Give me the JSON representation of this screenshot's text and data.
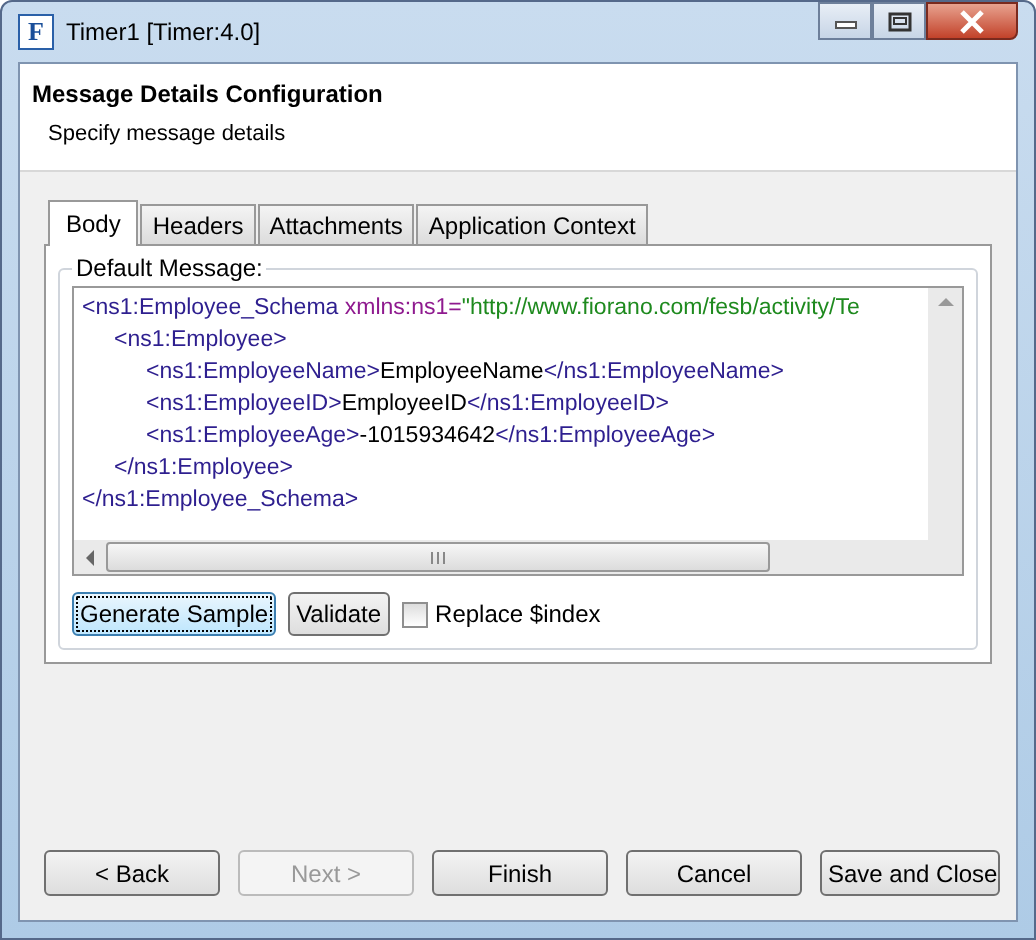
{
  "window": {
    "title": "Timer1 [Timer:4.0]",
    "app_icon": "F"
  },
  "header": {
    "title": "Message Details Configuration",
    "subtitle": "Specify message details"
  },
  "tabs": [
    {
      "label": "Body",
      "selected": true
    },
    {
      "label": "Headers",
      "selected": false
    },
    {
      "label": "Attachments",
      "selected": false
    },
    {
      "label": "Application Context",
      "selected": false
    }
  ],
  "group": {
    "label": "Default Message:"
  },
  "xml": [
    {
      "segments": [
        {
          "kind": "tag",
          "text": "<ns1:Employee_Schema "
        },
        {
          "kind": "attr",
          "text": "xmlns:ns1="
        },
        {
          "kind": "value",
          "text": "\"http://www.fiorano.com/fesb/activity/Te"
        }
      ],
      "children": [
        {
          "segments": [
            {
              "kind": "tag",
              "text": "<ns1:Employee>"
            }
          ],
          "children": [
            {
              "segments": [
                {
                  "kind": "tag",
                  "text": "<ns1:EmployeeName>"
                },
                {
                  "kind": "text",
                  "text": "EmployeeName"
                },
                {
                  "kind": "tag",
                  "text": "</ns1:EmployeeName>"
                }
              ]
            },
            {
              "segments": [
                {
                  "kind": "tag",
                  "text": "<ns1:EmployeeID>"
                },
                {
                  "kind": "text",
                  "text": "EmployeeID"
                },
                {
                  "kind": "tag",
                  "text": "</ns1:EmployeeID>"
                }
              ]
            },
            {
              "segments": [
                {
                  "kind": "tag",
                  "text": "<ns1:EmployeeAge>"
                },
                {
                  "kind": "text",
                  "text": "-1015934642"
                },
                {
                  "kind": "tag",
                  "text": "</ns1:EmployeeAge>"
                }
              ]
            }
          ]
        },
        {
          "segments": [
            {
              "kind": "tag",
              "text": "</ns1:Employee>"
            }
          ]
        }
      ]
    },
    {
      "segments": [
        {
          "kind": "tag",
          "text": "</ns1:Employee_Schema>"
        }
      ]
    }
  ],
  "actions": [
    {
      "label": "Generate Sample",
      "focused": true
    },
    {
      "label": "Validate",
      "focused": false
    }
  ],
  "replace_index": {
    "label": "Replace $index",
    "checked": false
  },
  "buttons": [
    {
      "label": "< Back",
      "disabled": false
    },
    {
      "label": "Next >",
      "disabled": true
    },
    {
      "label": "Finish",
      "disabled": false
    },
    {
      "label": "Cancel",
      "disabled": false
    },
    {
      "label": "Save and Close",
      "disabled": false
    }
  ]
}
